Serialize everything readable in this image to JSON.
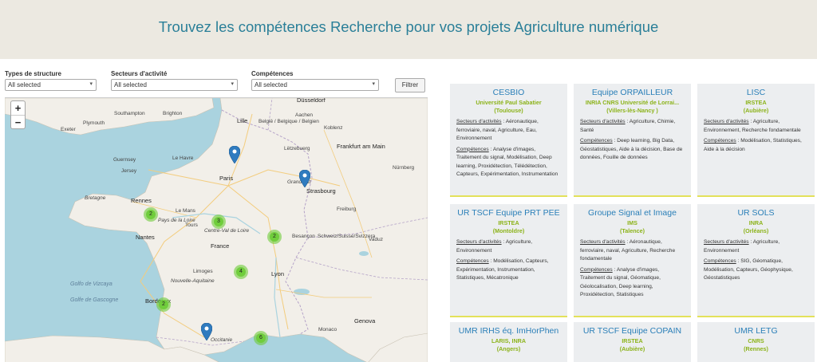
{
  "header": {
    "title": "Trouvez les compétences Recherche pour vos projets Agriculture numérique"
  },
  "filters": {
    "type_label": "Types de structure",
    "type_value": "All selected",
    "sector_label": "Secteurs d'activité",
    "sector_value": "All selected",
    "skill_label": "Compétences",
    "skill_value": "All selected",
    "button": "Filtrer"
  },
  "map": {
    "zoom_in": "+",
    "zoom_out": "−",
    "places": {
      "dusseldorf": "Düsseldorf",
      "lille": "Lille",
      "belgique": "België / Belgique / Belgien",
      "aachen": "Aachen",
      "koblenz": "Koblenz",
      "luxembourg": "Lëtzebuerg",
      "frankfurt": "Frankfurt am Main",
      "nurnberg": "Nürnberg",
      "strasbourg": "Strasbourg",
      "paris": "Paris",
      "le_havre": "Le Havre",
      "guernsey": "Guernsey",
      "jersey": "Jersey",
      "rennes": "Rennes",
      "le_mans": "Le Mans",
      "tours": "Tours",
      "nantes": "Nantes",
      "france": "France",
      "besancon": "Besançon",
      "schweiz": "Schweiz/Suisse/Svizzera",
      "lyon": "Lyon",
      "limoges": "Limoges",
      "bordeaux": "Bordeaux",
      "monaco": "Monaco",
      "genova": "Genova",
      "southampton": "Southampton",
      "brighton": "Brighton",
      "plymouth": "Plymouth",
      "exeter": "Exeter",
      "vaduz": "Vaduz",
      "freiburg": "Freiburg",
      "grand_est": "Grand Est",
      "centre": "Centre-Val de Loire",
      "nouvelle_aquitaine": "Nouvelle-Aquitaine",
      "occitanie": "Occitanie",
      "bretagne": "Bretagne",
      "pays_loire": "Pays de la Loire"
    },
    "seas": {
      "vizcaya": "Golfo de Vizcaya",
      "gascogne": "Golfe de Gascogne"
    },
    "clusters": [
      "2",
      "3",
      "2",
      "4",
      "2",
      "6"
    ]
  },
  "cards": [
    {
      "name": "CESBIO",
      "org": "Université Paul Sabatier",
      "loc": "(Toulouse)",
      "sector_label": "Secteurs d'activités",
      "sector": "Aéronautique, ferroviaire, naval, Agriculture, Eau, Environnement",
      "skill_label": "Compétences",
      "skill": "Analyse d'images, Traitement du signal, Modélisation, Deep learning, Proxidétection, Télédétection, Capteurs, Expérimentation, Instrumentation"
    },
    {
      "name": "Equipe ORPAILLEUR",
      "org": "INRIA CNRS Université de Lorrai...",
      "loc": "(Villers-lès-Nancy )",
      "sector_label": "Secteurs d'activités",
      "sector": "Agriculture, Chimie, Santé",
      "skill_label": "Compétences",
      "skill": "Deep learning, Big Data, Géostatistiques, Aide à la décision, Base de données, Fouille de données"
    },
    {
      "name": "LISC",
      "org": "IRSTEA",
      "loc": "(Aubière)",
      "sector_label": "Secteurs d'activités",
      "sector": "Agriculture, Environnement, Recherche fondamentale",
      "skill_label": "Compétences",
      "skill": "Modélisation, Statistiques, Aide à la décision"
    },
    {
      "name": "UR TSCF Equipe PRT PEE",
      "org": "IRSTEA",
      "loc": "(Montoldre)",
      "sector_label": "Secteurs d'activités",
      "sector": "Agriculture, Environnement",
      "skill_label": "Compétences",
      "skill": "Modélisation, Capteurs, Expérimentation, Instrumentation, Statistiques, Mécatronique"
    },
    {
      "name": "Groupe Signal et Image",
      "org": "IMS",
      "loc": "(Talence)",
      "sector_label": "Secteurs d'activités",
      "sector": "Aéronautique, ferroviaire, naval, Agriculture, Recherche fondamentale",
      "skill_label": "Compétences",
      "skill": "Analyse d'images, Traitement du signal, Géomatique, Géolocalisation, Deep learning, Proxidétection, Statistiques"
    },
    {
      "name": "UR SOLS",
      "org": "INRA",
      "loc": "(Orléans)",
      "sector_label": "Secteurs d'activités",
      "sector": "Agriculture, Environnement",
      "skill_label": "Compétences",
      "skill": "SIG, Géomatique, Modélisation, Capteurs, Géophysique, Géostatistiques"
    },
    {
      "name": "UMR IRHS éq. ImHorPhen",
      "org": "LARIS, INRA",
      "loc": "(Angers)"
    },
    {
      "name": "UR TSCF Equipe COPAIN",
      "org": "IRSTEA",
      "loc": "(Aubière)"
    },
    {
      "name": "UMR LETG",
      "org": "CNRS",
      "loc": "(Rennes)"
    }
  ],
  "colors": {
    "title": "#2a7f98",
    "card_name": "#2a7fb8",
    "card_org": "#8cb31a",
    "card_border": "#e3e15a",
    "cluster": "#6ecc39",
    "marker": "#2f7bbf"
  }
}
